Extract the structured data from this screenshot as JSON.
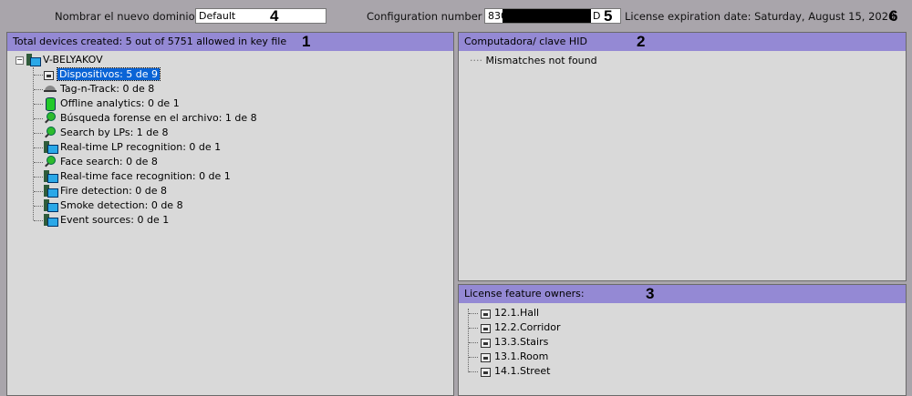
{
  "top": {
    "domain_label": "Nombrar el nuevo dominio",
    "domain_value": "Default",
    "config_label": "Configuration number",
    "config_value_prefix": "830",
    "config_value_suffix": "D",
    "expiration": "License expiration date: Saturday, August 15, 2020"
  },
  "callouts": [
    "1",
    "2",
    "3",
    "4",
    "5",
    "6"
  ],
  "left": {
    "header": "Total devices created: 5 out of 5751 allowed in key file",
    "root": "V-BELYAKOV",
    "items": [
      {
        "label": "Dispositivos: 5 de 9",
        "icon": "camera-icon"
      },
      {
        "label": "Tag-n-Track: 0 de 8",
        "icon": "dome-camera-icon"
      },
      {
        "label": "Offline analytics: 0 de 1",
        "icon": "database-icon"
      },
      {
        "label": "Búsqueda forense en el archivo: 1 de 8",
        "icon": "search-icon"
      },
      {
        "label": "Search by LPs: 1 de 8",
        "icon": "search-icon"
      },
      {
        "label": "Real-time LP recognition: 0 de 1",
        "icon": "computer-icon"
      },
      {
        "label": "Face search: 0 de 8",
        "icon": "search-icon"
      },
      {
        "label": "Real-time face recognition: 0 de 1",
        "icon": "computer-icon"
      },
      {
        "label": "Fire detection: 0 de 8",
        "icon": "computer-icon"
      },
      {
        "label": "Smoke detection: 0 de 8",
        "icon": "computer-icon"
      },
      {
        "label": "Event sources: 0 de 1",
        "icon": "computer-icon"
      }
    ]
  },
  "hid": {
    "header": "Computadora/ clave HID",
    "message": "Mismatches not found"
  },
  "owners": {
    "header": "License feature owners:",
    "items": [
      "12.1.Hall",
      "12.2.Corridor",
      "13.3.Stairs",
      "13.1.Room",
      "14.1.Street"
    ]
  }
}
